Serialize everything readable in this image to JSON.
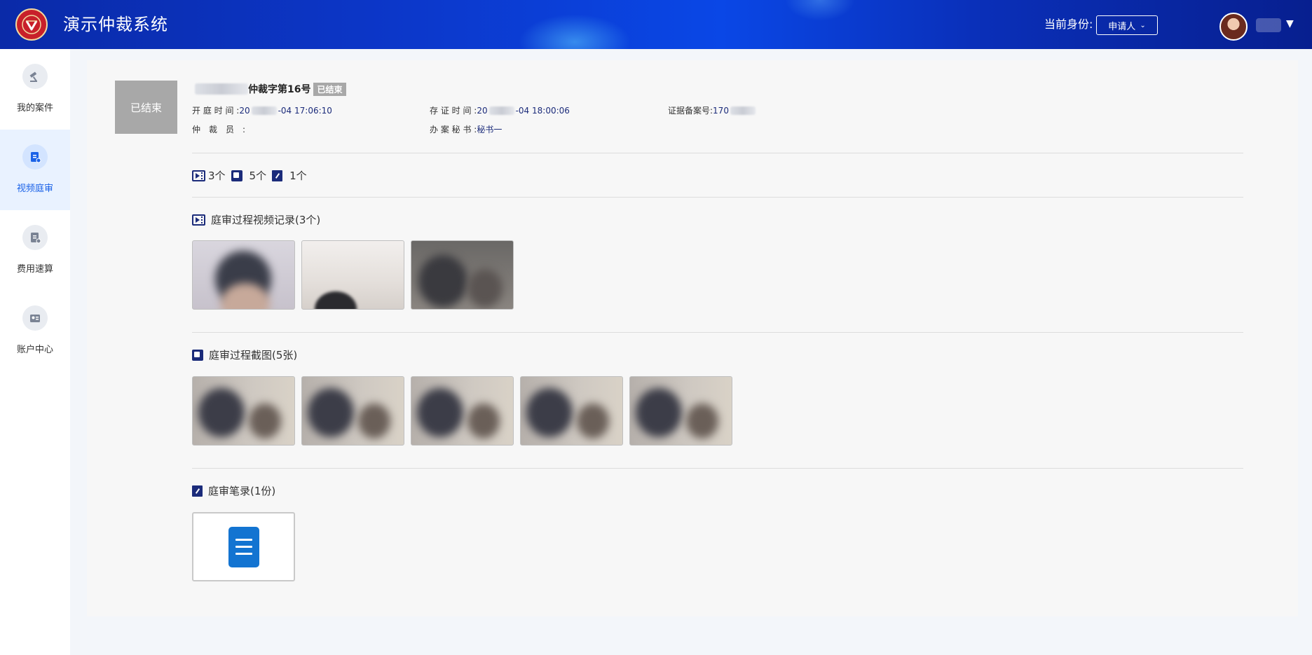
{
  "header": {
    "app_title": "演示仲裁系统",
    "role_label": "当前身份:",
    "role_value": "申请人",
    "username": "用户"
  },
  "sidebar": {
    "items": [
      {
        "label": "我的案件",
        "icon": "gavel-icon",
        "active": false
      },
      {
        "label": "视频庭审",
        "icon": "video-trial-icon",
        "active": true
      },
      {
        "label": "费用速算",
        "icon": "fee-calculator-icon",
        "active": false
      },
      {
        "label": "账户中心",
        "icon": "account-card-icon",
        "active": false
      }
    ]
  },
  "case": {
    "status_box": "已结束",
    "title_suffix": "仲裁字第16号",
    "badge": "已结束",
    "open_time_label": "开 庭 时 间 :",
    "open_time_prefix": "20",
    "open_time_suffix": "-04 17:06:10",
    "evidence_time_label": "存 证 时 间 :",
    "evidence_time_prefix": "20",
    "evidence_time_suffix": "-04 18:00:06",
    "record_no_label": "证据备案号:",
    "record_no_prefix": "170",
    "arbitrator_label": "仲　裁　员　:",
    "secretary_label": "办 案 秘 书 :",
    "secretary_value": "秘书一"
  },
  "counts": {
    "videos": "3个",
    "screenshots": "5个",
    "notes": "1个"
  },
  "sections": {
    "videos_title": "庭审过程视频记录(3个)",
    "screenshots_title": "庭审过程截图(5张)",
    "notes_title": "庭审笔录(1份)"
  },
  "colors": {
    "header_blue": "#0c37c9",
    "accent": "#1a62e8",
    "icon_navy": "#1b2b7a",
    "status_gray": "#a8a8a8",
    "doc_blue": "#1374d1"
  }
}
